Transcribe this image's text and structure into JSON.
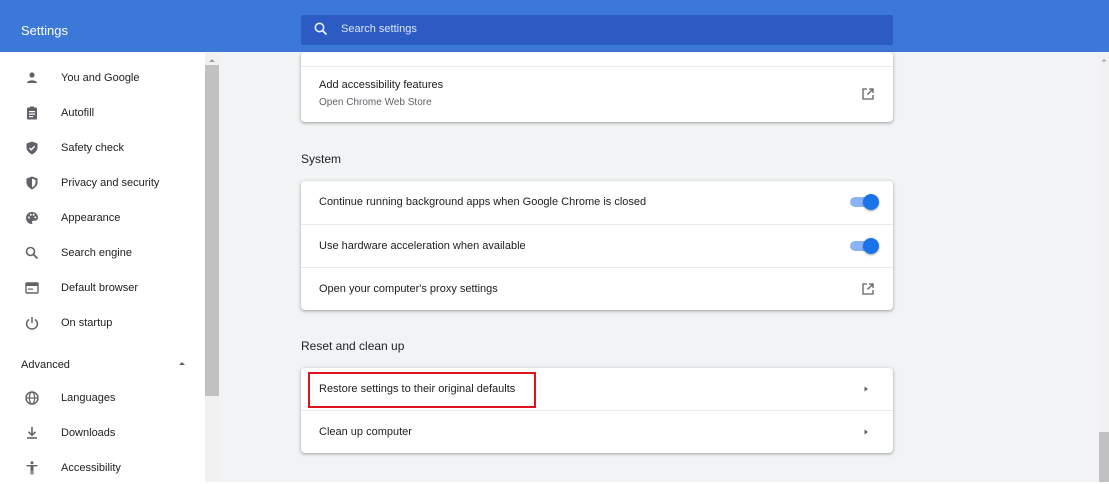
{
  "header": {
    "title": "Settings",
    "search_placeholder": "Search settings"
  },
  "sidebar": {
    "items": [
      {
        "label": "You and Google",
        "icon": "person-icon"
      },
      {
        "label": "Autofill",
        "icon": "clipboard-icon"
      },
      {
        "label": "Safety check",
        "icon": "shield-check-icon"
      },
      {
        "label": "Privacy and security",
        "icon": "shield-icon"
      },
      {
        "label": "Appearance",
        "icon": "palette-icon"
      },
      {
        "label": "Search engine",
        "icon": "search-icon"
      },
      {
        "label": "Default browser",
        "icon": "browser-window-icon"
      },
      {
        "label": "On startup",
        "icon": "power-icon"
      }
    ],
    "advanced_label": "Advanced",
    "advanced_items": [
      {
        "label": "Languages",
        "icon": "globe-icon"
      },
      {
        "label": "Downloads",
        "icon": "download-icon"
      },
      {
        "label": "Accessibility",
        "icon": "accessibility-icon"
      }
    ]
  },
  "main": {
    "accessibility_card": {
      "label": "Add accessibility features",
      "sublabel": "Open Chrome Web Store"
    },
    "system": {
      "title": "System",
      "rows": [
        {
          "label": "Continue running background apps when Google Chrome is closed",
          "toggle_on": true
        },
        {
          "label": "Use hardware acceleration when available",
          "toggle_on": true
        },
        {
          "label": "Open your computer's proxy settings"
        }
      ]
    },
    "reset": {
      "title": "Reset and clean up",
      "rows": [
        {
          "label": "Restore settings to their original defaults"
        },
        {
          "label": "Clean up computer"
        }
      ]
    }
  },
  "colors": {
    "header_bg": "#3c78d8",
    "search_bg": "#2c5cc3",
    "accent": "#1a73e8",
    "highlight": "#e1121b"
  }
}
